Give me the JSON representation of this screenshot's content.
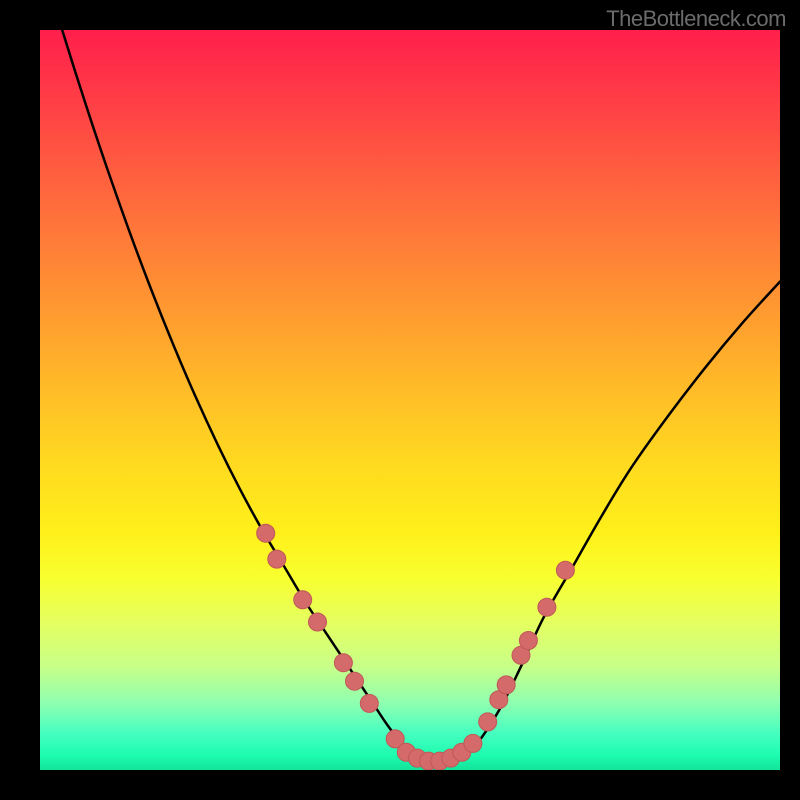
{
  "watermark": "TheBottleneck.com",
  "colors": {
    "frame_background": "#000000",
    "curve": "#000000",
    "marker_fill": "#d46a6a",
    "marker_stroke": "#c05858",
    "gradient_top": "#ff1f4b",
    "gradient_bottom": "#13e49a"
  },
  "chart_data": {
    "type": "line",
    "title": "",
    "xlabel": "",
    "ylabel": "",
    "xlim": [
      0,
      100
    ],
    "ylim": [
      0,
      100
    ],
    "curve": {
      "x": [
        0,
        3,
        6,
        9,
        12,
        15,
        18,
        21,
        24,
        27,
        30,
        33,
        36,
        39,
        42,
        45,
        47,
        49,
        51,
        53,
        55,
        57,
        59,
        62,
        65,
        68,
        72,
        76,
        80,
        85,
        90,
        95,
        100
      ],
      "y": [
        110,
        100,
        90.5,
        81.5,
        73,
        65,
        57.5,
        50.5,
        44,
        38,
        32.5,
        27.5,
        22.5,
        18,
        13.5,
        9,
        6,
        3.5,
        1.8,
        1,
        1,
        1.8,
        3.5,
        8,
        14,
        20.5,
        27.5,
        34.5,
        41,
        48,
        54.5,
        60.5,
        66
      ]
    },
    "markers": [
      {
        "x": 30.5,
        "y": 32
      },
      {
        "x": 32.0,
        "y": 28.5
      },
      {
        "x": 35.5,
        "y": 23
      },
      {
        "x": 37.5,
        "y": 20
      },
      {
        "x": 41.0,
        "y": 14.5
      },
      {
        "x": 42.5,
        "y": 12
      },
      {
        "x": 44.5,
        "y": 9
      },
      {
        "x": 48.0,
        "y": 4.2
      },
      {
        "x": 49.5,
        "y": 2.4
      },
      {
        "x": 51.0,
        "y": 1.6
      },
      {
        "x": 52.5,
        "y": 1.2
      },
      {
        "x": 54.0,
        "y": 1.2
      },
      {
        "x": 55.5,
        "y": 1.6
      },
      {
        "x": 57.0,
        "y": 2.4
      },
      {
        "x": 58.5,
        "y": 3.6
      },
      {
        "x": 60.5,
        "y": 6.5
      },
      {
        "x": 62.0,
        "y": 9.5
      },
      {
        "x": 63.0,
        "y": 11.5
      },
      {
        "x": 65.0,
        "y": 15.5
      },
      {
        "x": 66.0,
        "y": 17.5
      },
      {
        "x": 68.5,
        "y": 22
      },
      {
        "x": 71.0,
        "y": 27
      }
    ],
    "grid": false,
    "legend": false
  }
}
